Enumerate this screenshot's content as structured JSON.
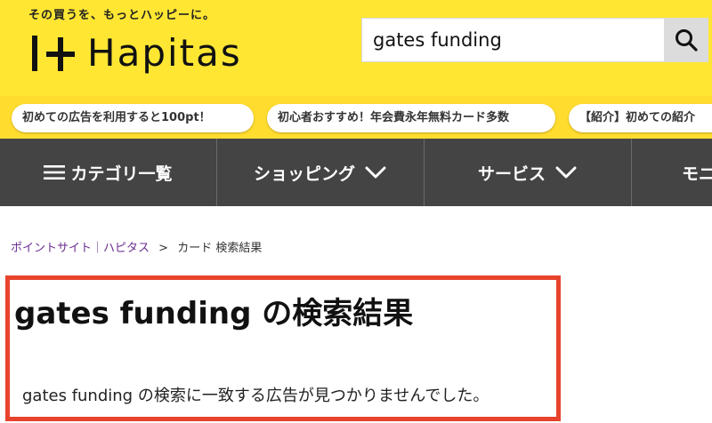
{
  "header": {
    "tagline": "その買うを、もっとハッピーに。",
    "logo_text": "Hapitas",
    "search_value": "gates funding"
  },
  "promos": [
    {
      "label": "初めての広告を利用すると100pt！"
    },
    {
      "label": "初心者おすすめ！年会費永年無料カード多数"
    },
    {
      "label": "【紹介】初めての紹介"
    }
  ],
  "nav": {
    "items": [
      {
        "label": "カテゴリ一覧"
      },
      {
        "label": "ショッピング"
      },
      {
        "label": "サービス"
      },
      {
        "label": "モニ"
      }
    ]
  },
  "breadcrumb": {
    "home": "ポイントサイト｜ハピタス",
    "separator": ">",
    "current": "カード 検索結果"
  },
  "result": {
    "title": "gates funding の検索結果",
    "message": "gates funding の検索に一致する広告が見つかりませんでした。"
  },
  "colors": {
    "header_bg": "#ffe633",
    "promo_bg": "#ffdc2e",
    "nav_bg": "#444444",
    "highlight_border": "#e8432d",
    "link": "#6a2c8f"
  },
  "icons": {
    "search": "search-icon",
    "menu": "hamburger-icon",
    "dropdown": "chevron-down-icon",
    "logo": "hapitas-logo-mark"
  }
}
